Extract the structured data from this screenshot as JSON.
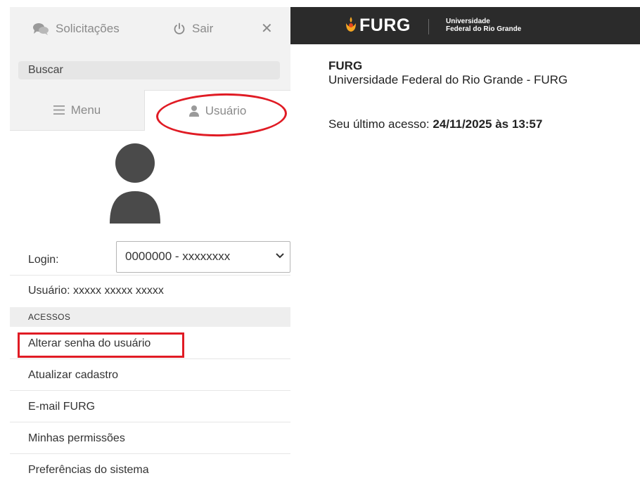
{
  "sidebar": {
    "top": {
      "requests_label": "Solicitações",
      "logout_label": "Sair",
      "close_glyph": "✕"
    },
    "search": {
      "placeholder": "Buscar"
    },
    "tabs": [
      {
        "label": "Menu",
        "icon": "hamburger-icon"
      },
      {
        "label": "Usuário",
        "icon": "person-icon",
        "active": true
      }
    ],
    "login": {
      "label": "Login:",
      "selected": "0000000 - xxxxxxxx"
    },
    "user_line": "Usuário: xxxxx xxxxx xxxxx",
    "section_title": "ACESSOS",
    "access_items": [
      "Alterar senha do usuário",
      "Atualizar cadastro",
      "E-mail FURG",
      "Minhas permissões",
      "Preferências do sistema"
    ]
  },
  "header": {
    "logo_text": "FURG",
    "logo_sub_line1": "Universidade",
    "logo_sub_line2": "Federal do Rio Grande"
  },
  "main": {
    "inst_short": "FURG",
    "inst_full": "Universidade Federal do Rio Grande - FURG",
    "last_access_label": "Seu último acesso:",
    "last_access_value": "24/11/2025 às 13:57"
  },
  "colors": {
    "header_bg": "#2b2b2b",
    "sidebar_bg": "#f2f2f2",
    "highlight": "#e01b24",
    "logo_accent": "#f5a623"
  }
}
